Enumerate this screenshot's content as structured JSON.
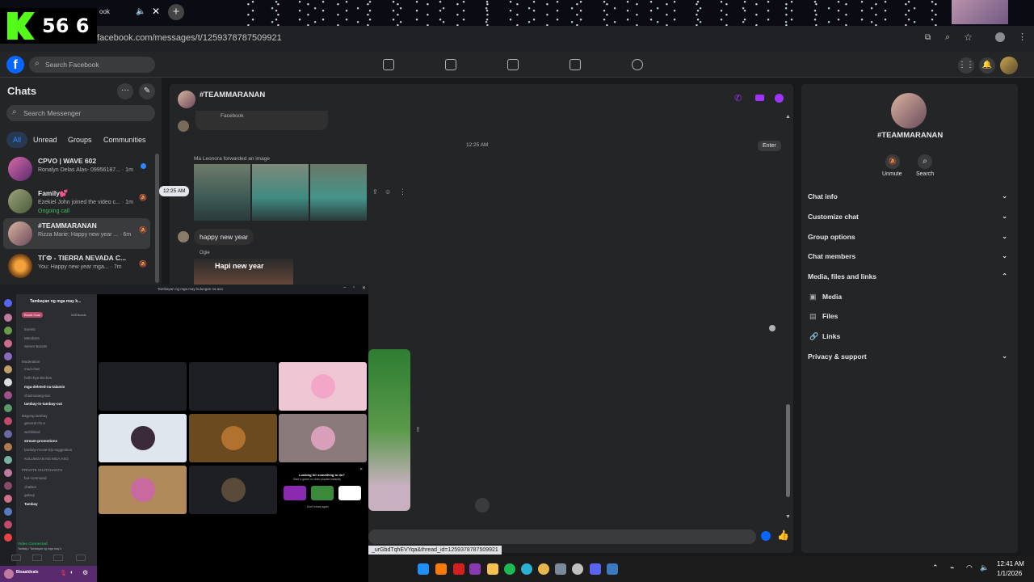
{
  "browser": {
    "tab_title": "ook",
    "url": "facebook.com/messages/t/1259378787509921"
  },
  "stream_overlay": {
    "viewer_count": "56 6"
  },
  "facebook": {
    "search_placeholder": "Search Facebook",
    "sidebar": {
      "title": "Chats",
      "search_placeholder": "Search Messenger",
      "filters": [
        "All",
        "Unread",
        "Groups",
        "Communities"
      ],
      "chats": [
        {
          "name": "CPVO | WAVE 602",
          "snippet": "Ronalyn Delas Alas- 09956187... · 1m",
          "extra": ""
        },
        {
          "name": "Family💕",
          "snippet": "Ezekiel John joined the video c... · 1m",
          "extra": "Ongoing call"
        },
        {
          "name": "#TEAMMARANAN",
          "snippet": "Rizza Marie: Happy new year ... · 6m",
          "extra": ""
        },
        {
          "name": "TΓΦ - TIERRA NEVADA C...",
          "snippet": "You: Happy new year mga... · 7m",
          "extra": ""
        }
      ]
    },
    "conversation": {
      "title": "#TEAMMARANAN",
      "shared_label": "Facebook",
      "timestamp": "12:25 AM",
      "enter_tooltip": "Enter",
      "forward_note": "Ma Leonora forwarded an image",
      "hover_time": "12:25 AM",
      "message_text": "happy new year",
      "sender_name": "Ogie",
      "gif_caption": "Hapi new year",
      "status_link": "_urGbdTqhEVYqa&thread_id=1259378787509921"
    },
    "right_panel": {
      "group_name": "#TEAMMARANAN",
      "actions": [
        "Unmute",
        "Search"
      ],
      "sections": [
        "Chat info",
        "Customize chat",
        "Group options",
        "Chat members",
        "Media, files and links"
      ],
      "media_items": [
        "Media",
        "Files",
        "Links"
      ],
      "privacy": "Privacy & support"
    }
  },
  "discord": {
    "window_title": "Tambayan ng mga may kulungan na aso",
    "server_name": "Tambayan ng mga may k...",
    "boost_goal": "Boost Goal",
    "boosts": "0/28 Boosts",
    "channels": [
      "Events",
      "Members",
      "Server Boosts",
      "Moderation",
      "mod-chat",
      "hello-bye-bitches",
      "mga-deleted-na-talamis",
      "chismosang-bot",
      "tambay-in-tambay-out",
      "Bagong tambay",
      "general chi a",
      "wishlisted",
      "stream-promotions",
      "tambay-movie-trip-suggestion",
      "KULUNGAN NG MGA ASO",
      "PRIVATE CHATCHANTS",
      "bot-command",
      "chatbot",
      "galaxy",
      "Tambay"
    ],
    "voice_status": "Video Connected",
    "voice_channel": "Tambay / Tambayan ng mga may k",
    "username": "Bisaaldeals",
    "activity_prompt": "Looking for something to do?",
    "activity_sub": "Start a game or video playlist instantly",
    "dont_show": "Don't show again"
  },
  "taskbar": {
    "time": "12:41 AM",
    "date": "1/1/2026"
  },
  "colors": {
    "fb_blue": "#0866ff",
    "accent_purple": "#a033ff",
    "online_green": "#45bd62"
  }
}
